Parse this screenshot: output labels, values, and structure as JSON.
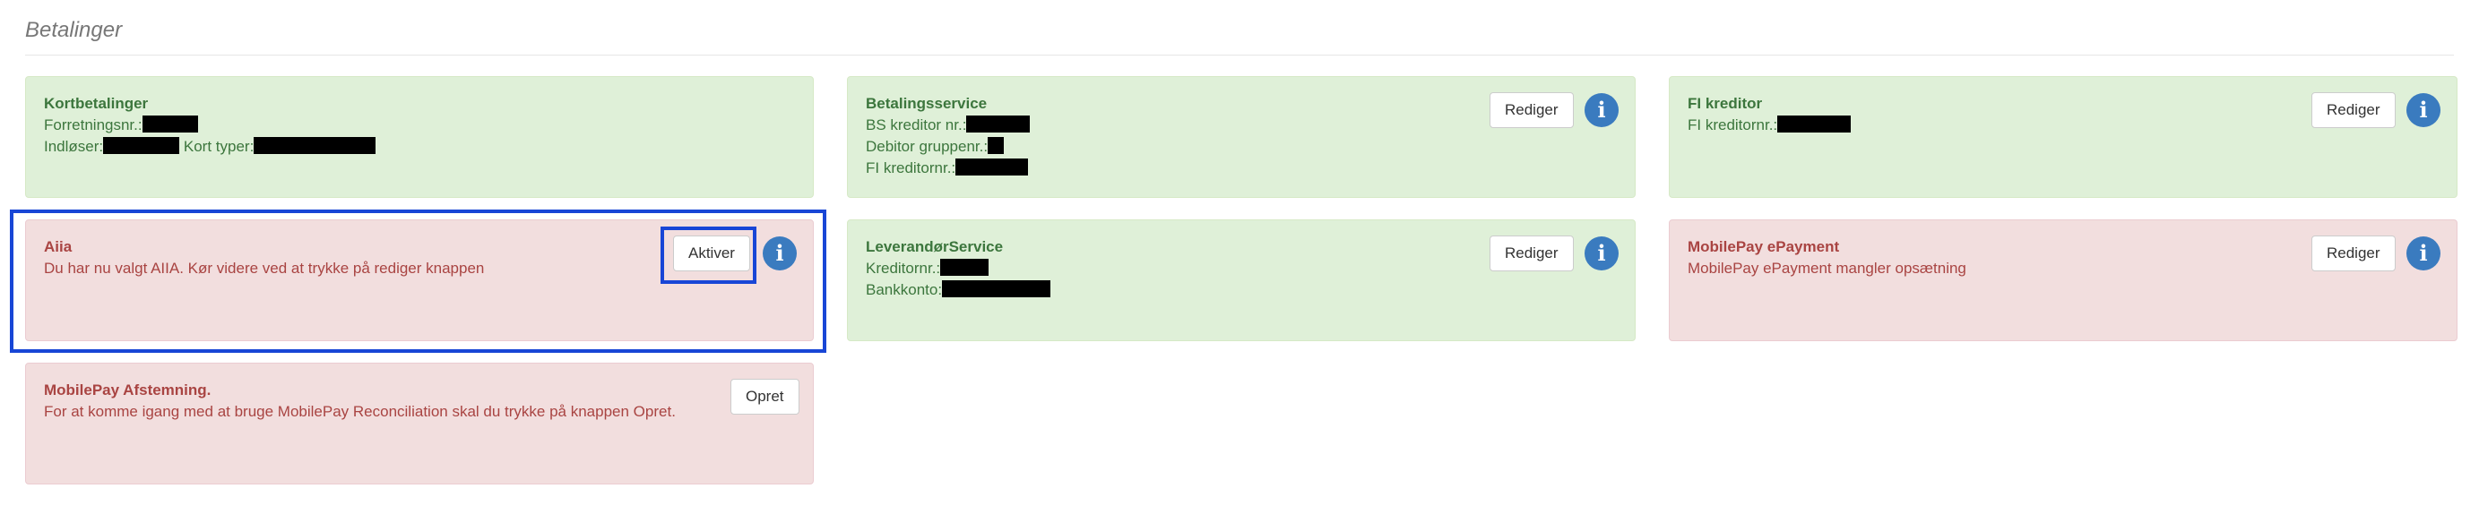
{
  "page": {
    "title": "Betalinger"
  },
  "cards": {
    "kortbetalinger": {
      "title": "Kortbetalinger",
      "line1_label": "Forretningsnr.:",
      "line2_label1": "Indløser:",
      "line2_label2": "Kort typer:"
    },
    "betalingsservice": {
      "title": "Betalingsservice",
      "line1_label": "BS kreditor nr.:",
      "line2_label": "Debitor gruppenr.:",
      "line3_label": "FI kreditornr.:",
      "button": "Rediger",
      "info_icon": "info-icon"
    },
    "fi_kreditor": {
      "title": "FI kreditor",
      "line1_label": "FI kreditornr.:",
      "button": "Rediger",
      "info_icon": "info-icon"
    },
    "aiia": {
      "title": "Aiia",
      "message": "Du har nu valgt AIIA. Kør videre ved at trykke på rediger knappen",
      "button": "Aktiver",
      "info_icon": "info-icon"
    },
    "leverandorservice": {
      "title": "LeverandørService",
      "line1_label": "Kreditornr.:",
      "line2_label": "Bankkonto:",
      "button": "Rediger",
      "info_icon": "info-icon"
    },
    "mobilepay_epayment": {
      "title": "MobilePay ePayment",
      "message": "MobilePay ePayment mangler opsætning",
      "button": "Rediger",
      "info_icon": "info-icon"
    },
    "mobilepay_afstemning": {
      "title": "MobilePay Afstemning.",
      "message": "For at komme igang med at bruge MobilePay Reconciliation skal du trykke på knappen Opret.",
      "button": "Opret"
    }
  },
  "colors": {
    "success_bg": "#dff0d8",
    "success_text": "#3c763d",
    "danger_bg": "#f2dede",
    "danger_text": "#a94442",
    "info_icon": "#3a7bbf",
    "highlight": "#1846d6"
  }
}
